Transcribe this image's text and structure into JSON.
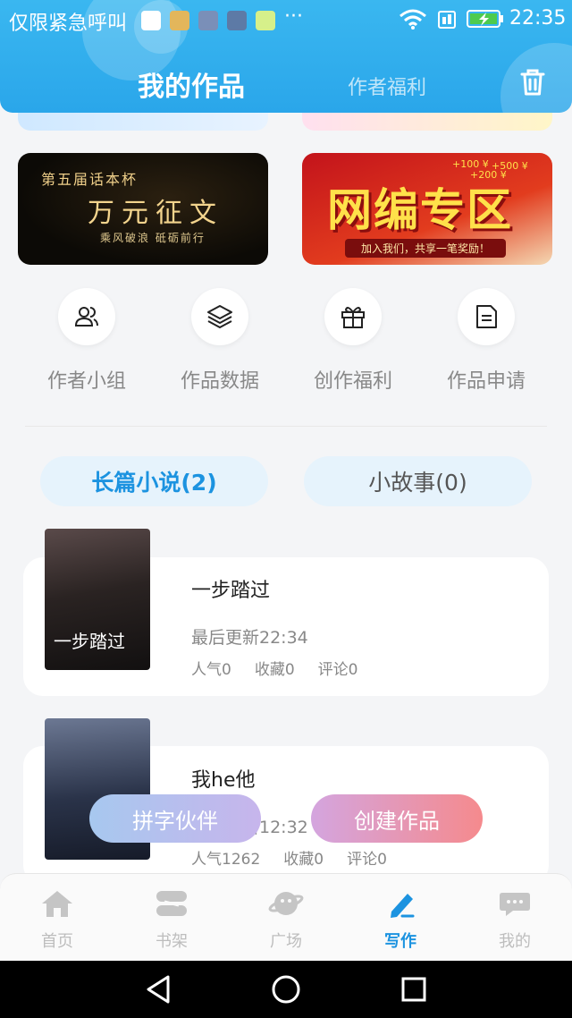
{
  "status_bar": {
    "left_text": "仅限紧急呼叫",
    "more": "···",
    "time": "22:35"
  },
  "header": {
    "tab_active": "我的作品",
    "tab_inactive": "作者福利",
    "trash_icon": "trash-icon"
  },
  "banners": {
    "essay": {
      "line1": "第五届话本杯",
      "line2": "万元征文",
      "line3": "乘风破浪 砥砺前行"
    },
    "net": {
      "line1": "网编专区",
      "line2": "加入我们，共享一笔奖励！",
      "money1": "+100 ¥",
      "money2": "+500 ¥",
      "money3": "+200 ¥"
    }
  },
  "quick_actions": [
    {
      "label": "作者小组",
      "icon": "users-icon"
    },
    {
      "label": "作品数据",
      "icon": "layers-icon"
    },
    {
      "label": "创作福利",
      "icon": "gift-icon"
    },
    {
      "label": "作品申请",
      "icon": "document-icon"
    }
  ],
  "tabs": {
    "long": "长篇小说(2)",
    "short": "小故事(0)"
  },
  "works": [
    {
      "title": "一步踏过",
      "updated": "最后更新22:34",
      "cover_text": "一步踏过",
      "stats": {
        "popularity": "人气0",
        "favorites": "收藏0",
        "comments": "评论0"
      }
    },
    {
      "title": "我he他",
      "updated": "最后更新12:32",
      "stats": {
        "popularity": "人气1262",
        "favorites": "收藏0",
        "comments": "评论0"
      }
    }
  ],
  "floating_buttons": {
    "partner": "拼字伙伴",
    "create": "创建作品"
  },
  "bottom_nav": [
    {
      "label": "首页",
      "icon": "home-icon"
    },
    {
      "label": "书架",
      "icon": "bookshelf-icon"
    },
    {
      "label": "广场",
      "icon": "planet-icon"
    },
    {
      "label": "写作",
      "icon": "pen-icon",
      "active": true
    },
    {
      "label": "我的",
      "icon": "chat-bubble-icon"
    }
  ],
  "colors": {
    "accent": "#1c93e0",
    "header": "#2aa6ea"
  }
}
